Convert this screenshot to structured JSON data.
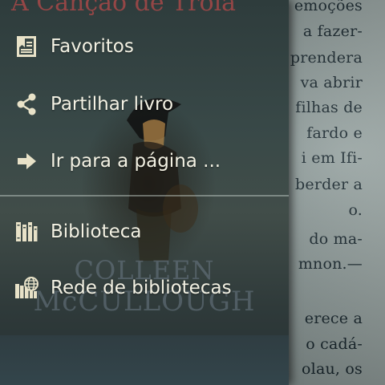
{
  "book": {
    "cover_title": "A Canção de Troia",
    "cover_author_line1": "COLLEEN",
    "cover_author_line2": "McCULLOUGH",
    "page_lines": [
      "emoções",
      "a fazer-",
      "prendera",
      "va abrir",
      "filhas de",
      "fardo e",
      "i em Ifi-",
      "berder a",
      "o.",
      "do ma-",
      "mnon.—",
      "",
      "erece a",
      "o cadá-",
      "olau, os"
    ]
  },
  "menu": {
    "items": [
      {
        "label": "Favoritos",
        "icon": "bookmarks-icon"
      },
      {
        "label": "Partilhar livro",
        "icon": "share-icon"
      },
      {
        "label": "Ir para a página ...",
        "icon": "arrow-right-icon"
      },
      {
        "label": "Biblioteca",
        "icon": "library-icon"
      },
      {
        "label": "Rede de bibliotecas",
        "icon": "library-network-icon"
      }
    ]
  },
  "colors": {
    "menu_text": "#f3f1e3",
    "icon": "#e8e2c8",
    "page_text": "#14232a"
  }
}
